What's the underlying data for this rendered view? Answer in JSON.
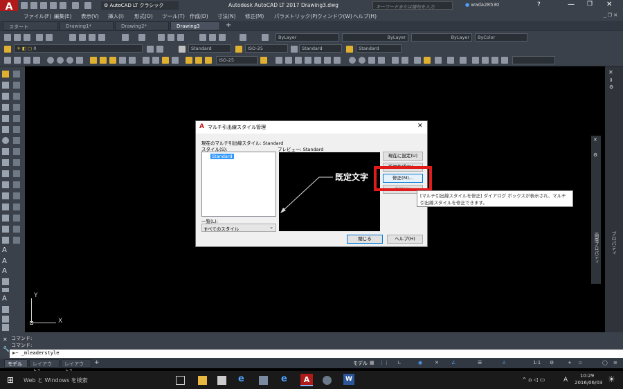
{
  "app": {
    "title": "Autodesk AutoCAD LT 2017    Drawing3.dwg",
    "workspace": "AutoCAD LT クラシック",
    "search_placeholder": "キーワードまたは語句を入力",
    "username": "wada28530",
    "logo_letter": "A",
    "logo_sub": "LT"
  },
  "menu": [
    "ファイル(F)",
    "編集(E)",
    "表示(V)",
    "挿入(I)",
    "形式(O)",
    "ツール(T)",
    "作成(D)",
    "寸法(N)",
    "修正(M)",
    "パラメトリック(P)",
    "ウィンドウ(W)",
    "ヘルプ(H)"
  ],
  "doc_tabs": [
    "スタート",
    "Drawing1*",
    "Drawing2*",
    "Drawing3"
  ],
  "toolbar": {
    "layer_combo": "ByLayer",
    "linetype_combo": "ByLayer",
    "lineweight_combo": "ByLayer",
    "color_combo": "ByColor",
    "layer_name": "0",
    "text_style": "Standard",
    "dim_style": "ISO-25",
    "table_style": "Standard",
    "mleader_style": "Standard",
    "dim_style2": "ISO-25"
  },
  "dialog": {
    "title": "マルチ引出線スタイル管理",
    "current_style": "現在のマルチ引出線スタイル: Standard",
    "styles_label": "スタイル(S):",
    "preview_label": "プレビュー: Standard",
    "styles": [
      "Standard"
    ],
    "list_label": "一覧(L):",
    "list_value": "すべてのスタイル",
    "preview_text": "既定文字",
    "buttons": {
      "set_current": "現在に設定(U)",
      "new": "新規作成(N)...",
      "modify": "修正(M)...",
      "delete": "削除(D)",
      "close": "閉じる",
      "help": "ヘルプ(H)"
    }
  },
  "tooltip": "[マルチ引出線スタイルを修正] ダイアログ ボックスが表示され、マルチ引出線スタイルを修正できます。",
  "command": {
    "history": [
      "コマンド:",
      "コマンド:"
    ],
    "input": "_mleaderstyle"
  },
  "layout_tabs": [
    "モデル",
    "レイアウト1",
    "レイアウト2"
  ],
  "status": {
    "model": "モデル",
    "scale": "1:1"
  },
  "ucs": {
    "x": "X",
    "y": "Y"
  },
  "right_panel": {
    "label1": "画層プロパティ",
    "label2": "プロパティ"
  },
  "taskbar": {
    "search": "Web と Windows を検索",
    "time": "10:29",
    "date": "2016/06/03",
    "ime": "A"
  },
  "colors": {
    "accent_red": "#e11a1a",
    "canvas": "#000000",
    "chrome": "#3b414a"
  }
}
